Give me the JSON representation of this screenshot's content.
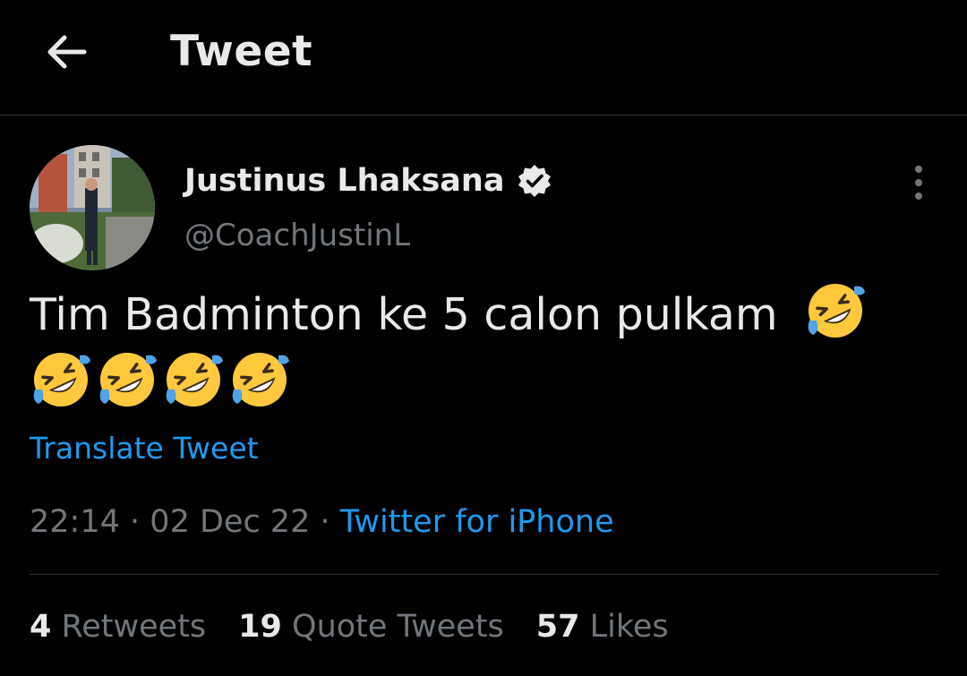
{
  "header": {
    "title": "Tweet",
    "back_icon": "arrow-left-icon"
  },
  "tweet": {
    "author": {
      "display_name": "Justinus Lhaksana",
      "handle": "@CoachJustinL",
      "verified": true,
      "verified_icon": "verified-badge-icon"
    },
    "text": "Tim Badminton ke 5 calon pulkam",
    "emojis": [
      "🤣",
      "🤣",
      "🤣",
      "🤣",
      "🤣"
    ],
    "translate_label": "Translate Tweet",
    "time": "22:14",
    "separator": "·",
    "date": "02 Dec 22",
    "source": "Twitter for iPhone",
    "stats": {
      "retweets_count": "4",
      "retweets_label": "Retweets",
      "quotes_count": "19",
      "quotes_label": "Quote Tweets",
      "likes_count": "57",
      "likes_label": "Likes"
    }
  },
  "colors": {
    "background": "#000000",
    "text_primary": "#e7e9ea",
    "text_secondary": "#71767b",
    "accent": "#1d9bf0",
    "divider": "#2f3336"
  }
}
